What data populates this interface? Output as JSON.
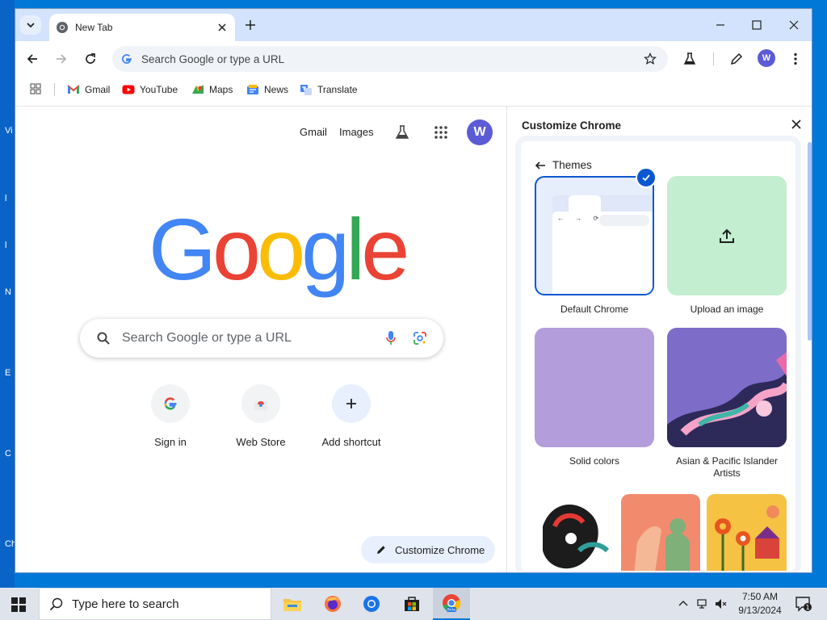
{
  "desktop": {
    "edge_labels": [
      "Vi",
      "l",
      "l",
      "N",
      "E",
      "C",
      "Ch"
    ]
  },
  "tab": {
    "title": "New Tab"
  },
  "omnibox": {
    "placeholder": "Search Google or type a URL"
  },
  "profile": {
    "initial": "W"
  },
  "bookmarks": [
    {
      "label": "Gmail",
      "icon": "gmail-icon"
    },
    {
      "label": "YouTube",
      "icon": "youtube-icon"
    },
    {
      "label": "Maps",
      "icon": "maps-icon"
    },
    {
      "label": "News",
      "icon": "news-icon"
    },
    {
      "label": "Translate",
      "icon": "translate-icon"
    }
  ],
  "ntp": {
    "gmail_link": "Gmail",
    "images_link": "Images",
    "logo": "Google",
    "search_placeholder": "Search Google or type a URL",
    "shortcuts": [
      {
        "label": "Sign in"
      },
      {
        "label": "Web Store"
      },
      {
        "label": "Add shortcut"
      }
    ],
    "customize_button": "Customize Chrome"
  },
  "panel": {
    "title": "Customize Chrome",
    "back_label": "Themes",
    "themes": [
      {
        "label": "Default Chrome",
        "selected": true
      },
      {
        "label": "Upload an image"
      },
      {
        "label": "Solid colors"
      },
      {
        "label": "Asian & Pacific Islander Artists"
      }
    ],
    "mini_browser_nav": "← → ⟳"
  },
  "taskbar": {
    "search_placeholder": "Type here to search",
    "time": "7:50 AM",
    "date": "9/13/2024",
    "notification_count": "1",
    "chrome_badge": "Beta"
  },
  "colors": {
    "accent": "#0b57d0",
    "avatar": "#5b5bd6",
    "tabstrip": "#d3e3fd",
    "desktop": "#0078d7",
    "google_blue": "#4285f4",
    "google_red": "#ea4335",
    "google_yellow": "#fbbc05",
    "google_green": "#34a853"
  }
}
